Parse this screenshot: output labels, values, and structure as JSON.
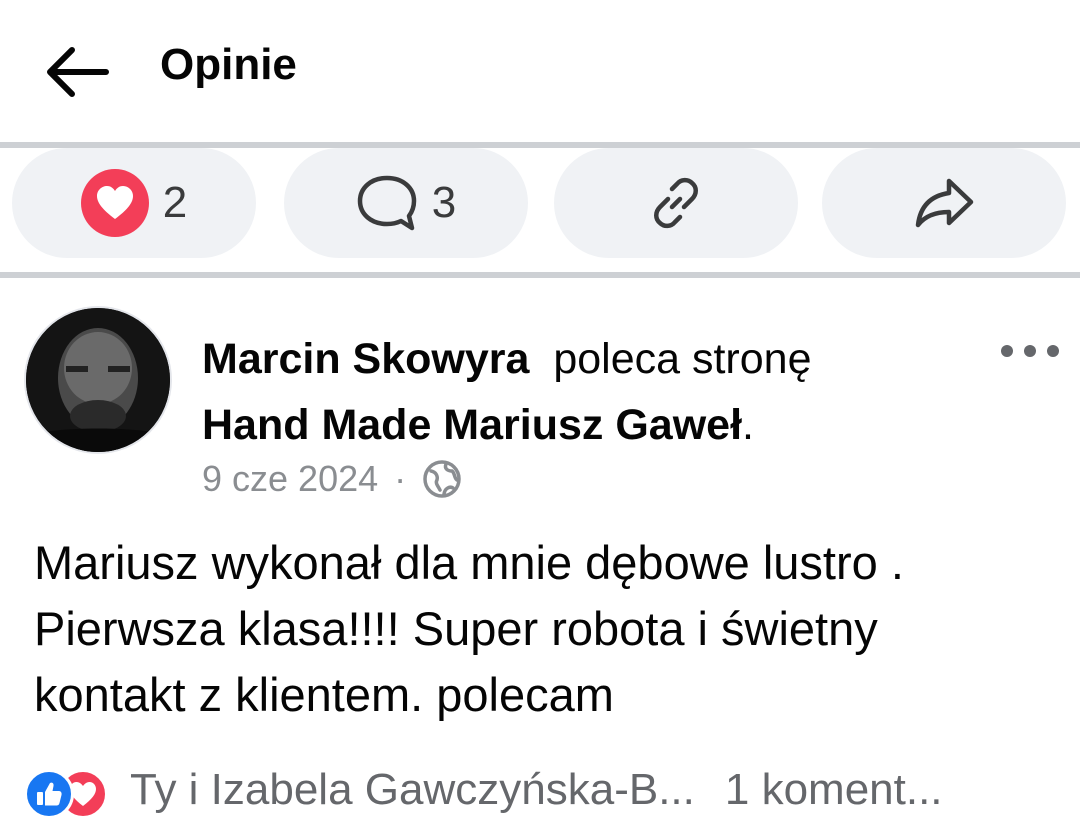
{
  "header": {
    "title": "Opinie"
  },
  "actions": {
    "reactions_count": "2",
    "comments_count": "3"
  },
  "post": {
    "author": "Marcin Skowyra",
    "verb": "poleca stronę",
    "page_name": "Hand Made Mariusz Gaweł",
    "period": ".",
    "date": "9 cze 2024",
    "separator": "·",
    "body_line1": "Mariusz wykonał dla mnie dębowe lustro .",
    "body_line2": "Pierwsza klasa!!!! Super robota i świetny",
    "body_line3": "kontakt z klientem.  polecam",
    "reactors": "Ty i Izabela Gawczyńska-B...",
    "comments_label": "1 koment..."
  },
  "colors": {
    "love": "#f33e58",
    "like": "#1877f2",
    "pill_bg": "#f0f2f5",
    "divider": "#cdd0d4"
  }
}
